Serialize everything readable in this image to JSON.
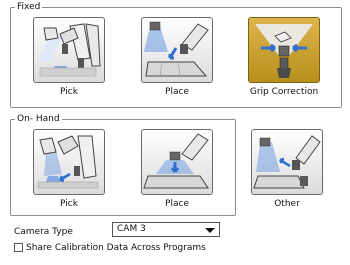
{
  "fixed": {
    "title": "Fixed",
    "tiles": [
      {
        "label": "Pick",
        "icon": "fixed-pick-icon"
      },
      {
        "label": "Place",
        "icon": "fixed-place-icon"
      },
      {
        "label": "Grip Correction",
        "icon": "grip-correction-icon",
        "selected": true
      }
    ]
  },
  "on_hand": {
    "title": "On- Hand",
    "tiles": [
      {
        "label": "Pick",
        "icon": "onhand-pick-icon"
      },
      {
        "label": "Place",
        "icon": "onhand-place-icon"
      },
      {
        "label": "Other",
        "icon": "other-icon"
      }
    ]
  },
  "camera_type": {
    "label": "Camera Type",
    "value": "CAM 3"
  },
  "share_calibration": {
    "label": "Share Calibration Data Across Programs",
    "checked": false
  },
  "colors": {
    "selected_tile": "#c9a23a",
    "camera_light": "#5b8fe0",
    "arrow": "#2f6fd0"
  }
}
